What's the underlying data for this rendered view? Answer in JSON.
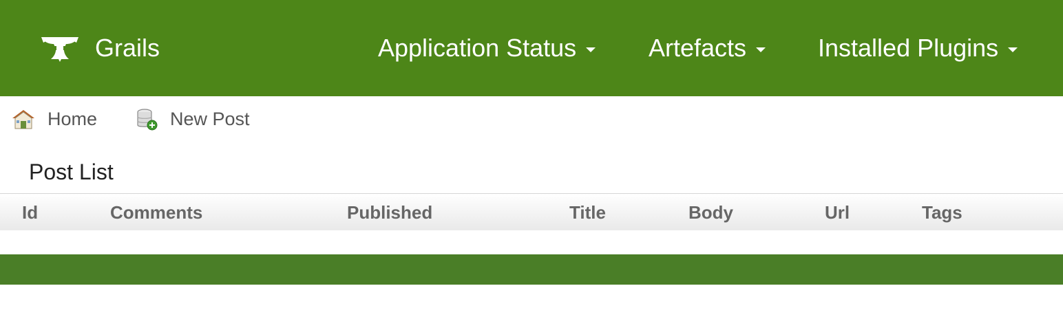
{
  "navbar": {
    "brand_icon": "grails-logo-icon",
    "brand_label": "Grails",
    "menus": [
      {
        "label": "Application Status",
        "icon": "caret-down-icon"
      },
      {
        "label": "Artefacts",
        "icon": "caret-down-icon"
      },
      {
        "label": "Installed Plugins",
        "icon": "caret-down-icon"
      }
    ],
    "background": "#4d8618"
  },
  "subnav": {
    "home_label": "Home",
    "home_icon": "house-icon",
    "new_label": "New Post",
    "new_icon": "database-add-icon"
  },
  "main": {
    "title": "Post List",
    "table": {
      "columns": [
        "Id",
        "Comments",
        "Published",
        "Title",
        "Body",
        "Url",
        "Tags"
      ],
      "rows": []
    }
  },
  "footer": {
    "background": "#4a7e27"
  }
}
